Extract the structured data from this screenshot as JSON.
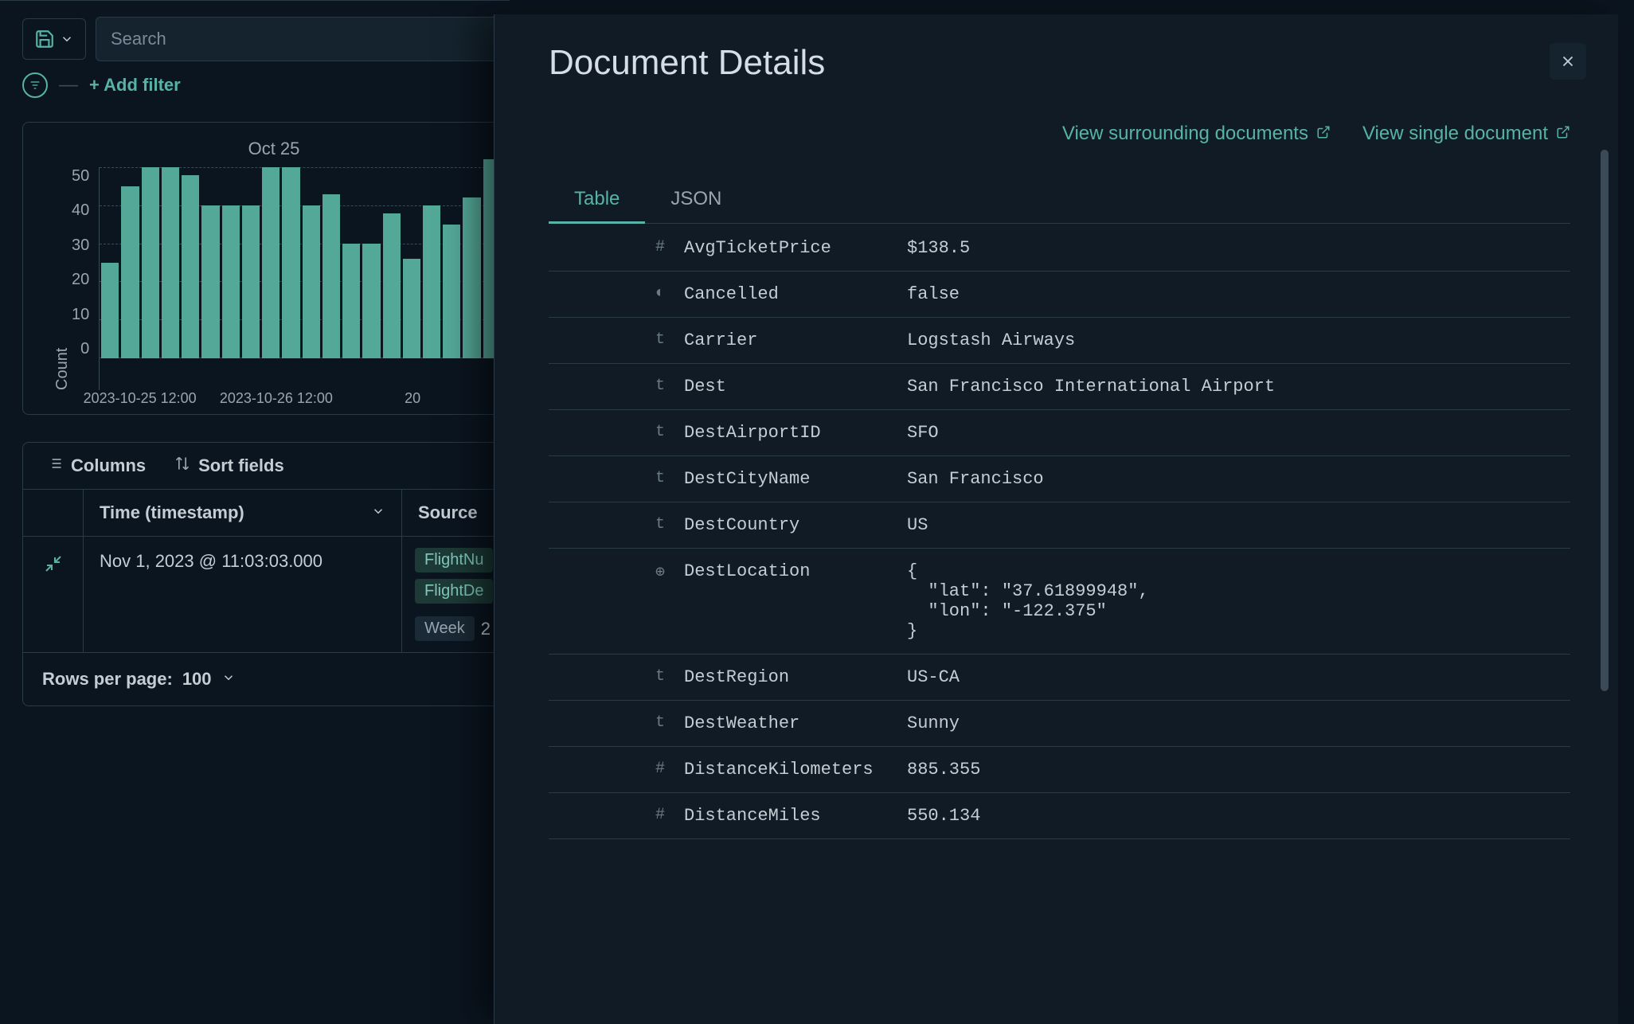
{
  "toolbar": {
    "search_placeholder": "Search",
    "add_filter_label": "+ Add filter"
  },
  "chart_data": {
    "type": "bar",
    "title_fragment": "Oct 25",
    "ylabel": "Count",
    "ylim": [
      0,
      50
    ],
    "yticks": [
      50,
      40,
      30,
      20,
      10,
      0
    ],
    "x_ticks": [
      {
        "label": "2023-10-25 12:00",
        "pos": 10
      },
      {
        "label": "2023-10-26 12:00",
        "pos": 44
      },
      {
        "label": "20",
        "pos": 78
      }
    ],
    "values": [
      25,
      45,
      50,
      50,
      48,
      40,
      40,
      40,
      50,
      50,
      40,
      43,
      30,
      30,
      38,
      26,
      40,
      35,
      42,
      52
    ]
  },
  "table_controls": {
    "columns_label": "Columns",
    "sort_label": "Sort fields"
  },
  "table": {
    "col_time": "Time (timestamp)",
    "col_source": "Source",
    "row_time": "Nov 1, 2023 @ 11:03:03.000",
    "row_pills": [
      "FlightNu",
      "FlightDe"
    ],
    "row_week_label": "Week",
    "row_week_val": "2"
  },
  "pager": {
    "label": "Rows per page:",
    "value": "100"
  },
  "flyout": {
    "title": "Document Details",
    "link_surrounding": "View surrounding documents",
    "link_single": "View single document",
    "tab_table": "Table",
    "tab_json": "JSON",
    "rows": [
      {
        "icon": "#",
        "key": "AvgTicketPrice",
        "val": "$138.5"
      },
      {
        "icon": "◐",
        "key": "Cancelled",
        "val": "false"
      },
      {
        "icon": "t",
        "key": "Carrier",
        "val": "Logstash Airways"
      },
      {
        "icon": "t",
        "key": "Dest",
        "val": "San Francisco International Airport"
      },
      {
        "icon": "t",
        "key": "DestAirportID",
        "val": "SFO"
      },
      {
        "icon": "t",
        "key": "DestCityName",
        "val": "San Francisco"
      },
      {
        "icon": "t",
        "key": "DestCountry",
        "val": "US"
      },
      {
        "icon": "⊕",
        "key": "DestLocation",
        "val": "{\n  \"lat\": \"37.61899948\",\n  \"lon\": \"-122.375\"\n}"
      },
      {
        "icon": "t",
        "key": "DestRegion",
        "val": "US-CA"
      },
      {
        "icon": "t",
        "key": "DestWeather",
        "val": "Sunny"
      },
      {
        "icon": "#",
        "key": "DistanceKilometers",
        "val": "885.355"
      },
      {
        "icon": "#",
        "key": "DistanceMiles",
        "val": "550.134"
      }
    ]
  }
}
